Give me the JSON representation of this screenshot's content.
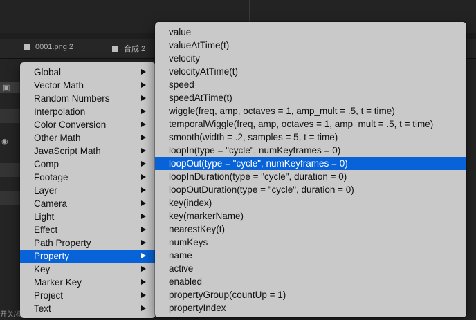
{
  "tabs": [
    {
      "label": "0001.png 2"
    },
    {
      "label": "合成 2"
    }
  ],
  "bottom_label": "开关/模",
  "colors": {
    "menu_bg": "#c9c9c9",
    "selection": "#0863d8"
  },
  "category_menu": {
    "items": [
      {
        "label": "Global"
      },
      {
        "label": "Vector Math"
      },
      {
        "label": "Random Numbers"
      },
      {
        "label": "Interpolation"
      },
      {
        "label": "Color Conversion"
      },
      {
        "label": "Other Math"
      },
      {
        "label": "JavaScript Math"
      },
      {
        "label": "Comp"
      },
      {
        "label": "Footage"
      },
      {
        "label": "Layer"
      },
      {
        "label": "Camera"
      },
      {
        "label": "Light"
      },
      {
        "label": "Effect"
      },
      {
        "label": "Path Property"
      },
      {
        "label": "Property"
      },
      {
        "label": "Key"
      },
      {
        "label": "Marker Key"
      },
      {
        "label": "Project"
      },
      {
        "label": "Text"
      }
    ],
    "selected": "Property"
  },
  "expression_menu": {
    "items": [
      {
        "label": "value"
      },
      {
        "label": "valueAtTime(t)"
      },
      {
        "label": "velocity"
      },
      {
        "label": "velocityAtTime(t)"
      },
      {
        "label": "speed"
      },
      {
        "label": "speedAtTime(t)"
      },
      {
        "label": "wiggle(freq, amp, octaves = 1, amp_mult = .5, t = time)"
      },
      {
        "label": "temporalWiggle(freq, amp, octaves = 1, amp_mult = .5, t = time)"
      },
      {
        "label": "smooth(width = .2, samples = 5, t = time)"
      },
      {
        "label": "loopIn(type = \"cycle\", numKeyframes = 0)"
      },
      {
        "label": "loopOut(type = \"cycle\", numKeyframes = 0)"
      },
      {
        "label": "loopInDuration(type = \"cycle\", duration = 0)"
      },
      {
        "label": "loopOutDuration(type = \"cycle\", duration = 0)"
      },
      {
        "label": "key(index)"
      },
      {
        "label": "key(markerName)"
      },
      {
        "label": "nearestKey(t)"
      },
      {
        "label": "numKeys"
      },
      {
        "label": "name"
      },
      {
        "label": "active"
      },
      {
        "label": "enabled"
      },
      {
        "label": "propertyGroup(countUp = 1)"
      },
      {
        "label": "propertyIndex"
      }
    ],
    "selected": "loopOut(type = \"cycle\", numKeyframes = 0)"
  }
}
